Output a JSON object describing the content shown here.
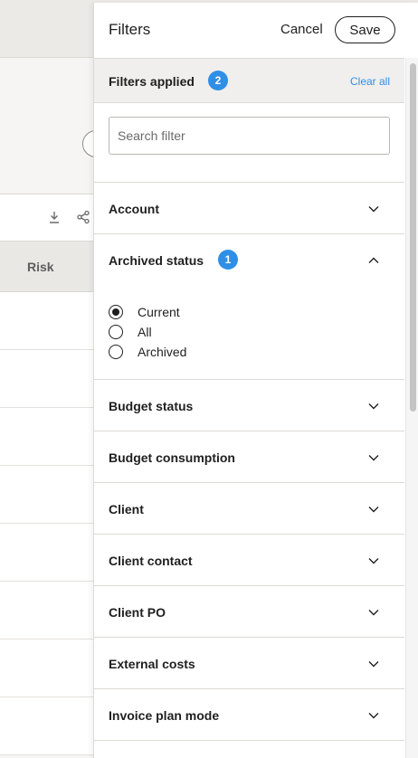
{
  "background": {
    "column_header": "Risk"
  },
  "drawer": {
    "title": "Filters",
    "cancel_label": "Cancel",
    "save_label": "Save",
    "applied": {
      "label": "Filters applied",
      "count": "2",
      "clear_all_label": "Clear all"
    },
    "search": {
      "placeholder": "Search filter",
      "value": ""
    },
    "sections": [
      {
        "label": "Account",
        "expanded": false
      },
      {
        "label": "Archived status",
        "expanded": true,
        "badge": "1",
        "options": [
          {
            "label": "Current",
            "checked": true
          },
          {
            "label": "All",
            "checked": false
          },
          {
            "label": "Archived",
            "checked": false
          }
        ]
      },
      {
        "label": "Budget status",
        "expanded": false
      },
      {
        "label": "Budget consumption",
        "expanded": false
      },
      {
        "label": "Client",
        "expanded": false
      },
      {
        "label": "Client contact",
        "expanded": false
      },
      {
        "label": "Client PO",
        "expanded": false
      },
      {
        "label": "External costs",
        "expanded": false
      },
      {
        "label": "Invoice plan mode",
        "expanded": false
      }
    ]
  },
  "colors": {
    "accent": "#2f8fe6",
    "text": "#1f1f1f",
    "divider": "#dcdad6"
  }
}
